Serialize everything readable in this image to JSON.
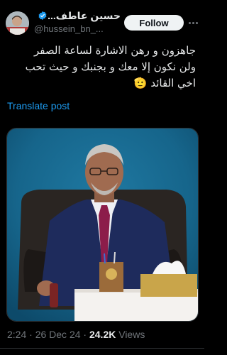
{
  "header": {
    "display_name": "حسين عاطف...",
    "handle": "@hussein_bn_...",
    "verified_icon": "verified-badge-icon",
    "follow_label": "Follow",
    "more_icon": "more-options-icon"
  },
  "tweet": {
    "lines": [
      "جاهزون و رهن الاشارة لساعة الصفر",
      "ولن نكون إلا معك و بجنبك و حيث تحب",
      "اخي القائد 🫡"
    ]
  },
  "translate_label": "Translate post",
  "media": {
    "alt": "photo"
  },
  "meta": {
    "time": "2:24",
    "date": "26 Dec 24",
    "views_count": "24.2K",
    "views_label": "Views"
  },
  "colors": {
    "background": "#000000",
    "accent": "#1d9bf0",
    "verified": "#1d9bf0",
    "secondary_text": "#71767b"
  }
}
